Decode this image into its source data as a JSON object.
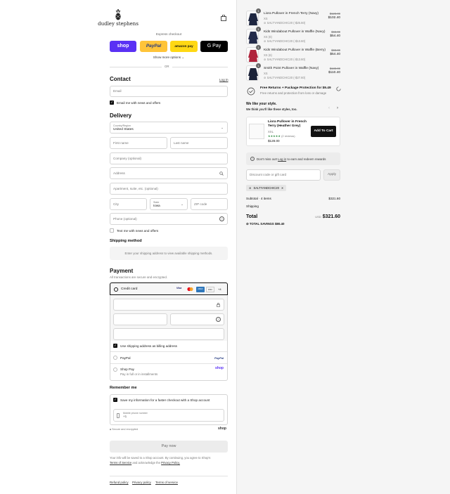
{
  "brand": {
    "name": "dudley stephens"
  },
  "express": {
    "label": "Express checkout",
    "buttons": [
      {
        "label": "shop",
        "color": "#5a31f4"
      },
      {
        "label": "PayPal",
        "color": "#ffc439"
      },
      {
        "label": "amazon pay",
        "color": "#ffd814"
      },
      {
        "label": "G Pay",
        "color": "#000000"
      }
    ],
    "show_more": "Show more options",
    "or": "OR"
  },
  "contact": {
    "title": "Contact",
    "login": "Log in",
    "email_placeholder": "Email",
    "news_label": "Email me with news and offers"
  },
  "delivery": {
    "title": "Delivery",
    "country_label": "Country/Region",
    "country_value": "United States",
    "first_name": "First name",
    "last_name": "Last name",
    "company": "Company (optional)",
    "address": "Address",
    "apartment": "Apartment, suite, etc. (optional)",
    "city": "City",
    "state_label": "State",
    "state_value": "Iowa",
    "zip": "ZIP code",
    "phone": "Phone (optional)",
    "text_news": "Text me with news and offers"
  },
  "shipping": {
    "title": "Shipping method",
    "note": "Enter your shipping address to view available shipping methods."
  },
  "payment": {
    "title": "Payment",
    "subtitle": "All transactions are secure and encrypted.",
    "credit_card": "Credit card",
    "card_brands": [
      "Visa",
      "MC",
      "AMEX",
      "DISC",
      "+4"
    ],
    "billing_same": "Use shipping address as billing address",
    "paypal": "PayPal",
    "paypal_logo": "PayPal",
    "shop_pay": "Shop Pay",
    "shop_pay_sub": "Pay in full or in installments",
    "shop_logo": "shop"
  },
  "remember": {
    "title": "Remember me",
    "save_info": "Save my information for a faster checkout with a Shop account",
    "mobile_label": "Mobile phone number",
    "mobile_value": "+1",
    "secure": "Secure and encrypted",
    "shop_logo": "shop"
  },
  "pay_now": "Pay now",
  "legal": {
    "text1": "Your info will be saved to a Shop account. By continuing, you agree to Shop's",
    "terms": "Terms of Service",
    "and": "and acknowledge the",
    "privacy": "Privacy Policy."
  },
  "footer_links": [
    "Refund policy",
    "Privacy policy",
    "Terms of service"
  ],
  "cart": {
    "items": [
      {
        "qty": "1",
        "title": "Liora Pullover in French Terry (Navy)",
        "variant": "XS",
        "discount": "SALTYANDCHIC20 (-$25.60)",
        "old_price": "$128.00",
        "price": "$102.40",
        "color": "#1e2640"
      },
      {
        "qty": "1",
        "title": "Kids Windabout Pullover in Waffle (Navy)",
        "variant": "XS (6)",
        "discount": "SALTYANDCHIC20 (-$13.60)",
        "old_price": "$68.00",
        "price": "$54.40",
        "color": "#232b4a"
      },
      {
        "qty": "1",
        "title": "Kids Windabout Pullover in Waffle (Berry)",
        "variant": "XS (6)",
        "discount": "SALTYANDCHIC20 (-$13.60)",
        "old_price": "$68.00",
        "price": "$54.40",
        "color": "#b0243c"
      },
      {
        "qty": "1",
        "title": "Smith Point Pullover in Waffle (Navy)",
        "variant": "XS",
        "discount": "SALTYANDCHIC20 (-$27.60)",
        "old_price": "$138.00",
        "price": "$110.40",
        "color": "#1b2238"
      }
    ],
    "returns_title": "Free Returns + Package Protection for $9.49",
    "returns_sub": "Free returns and protection from loss or damage",
    "upsell_title": "We like your style.",
    "upsell_sub": "We think you'll like these styles, too.",
    "upsell": {
      "title": "Liora Pullover in French Terry (Heather Grey)",
      "variant": "XXL",
      "reviews": "(2 reviews)",
      "stars": 5,
      "price": "$128.00",
      "button": "Add To Cart"
    },
    "rewards": "Don't miss out!",
    "rewards_login": "Log in",
    "rewards_rest": "to earn and redeem rewards",
    "discount_placeholder": "Discount code or gift card",
    "apply": "Apply",
    "applied_code": "SALTYANDCHIC20",
    "subtotal_label": "Subtotal · 4 items",
    "subtotal_value": "$321.60",
    "shipping_label": "Shipping",
    "total_label": "Total",
    "currency": "USD",
    "total_value": "$321.60",
    "savings_label": "TOTAL SAVINGS",
    "savings_value": "$80.40"
  }
}
